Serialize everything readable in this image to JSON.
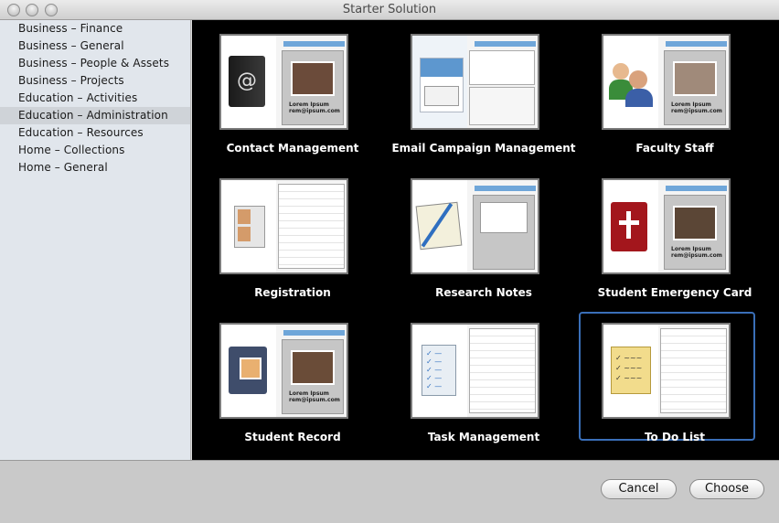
{
  "window": {
    "title": "Starter Solution"
  },
  "sidebar": {
    "items": [
      {
        "label": "Business – Finance",
        "selected": false
      },
      {
        "label": "Business – General",
        "selected": false
      },
      {
        "label": "Business – People & Assets",
        "selected": false
      },
      {
        "label": "Business – Projects",
        "selected": false
      },
      {
        "label": "Education – Activities",
        "selected": false
      },
      {
        "label": "Education – Administration",
        "selected": true
      },
      {
        "label": "Education – Resources",
        "selected": false
      },
      {
        "label": "Home – Collections",
        "selected": false
      },
      {
        "label": "Home – General",
        "selected": false
      }
    ]
  },
  "templates": [
    {
      "label": "Contact Management",
      "icon": "address-book-icon",
      "lorem": "Lorem Ipsum\nrem@ipsum.com"
    },
    {
      "label": "Email Campaign Management",
      "icon": "envelope-icon",
      "lorem": ""
    },
    {
      "label": "Faculty Staff",
      "icon": "people-icon",
      "lorem": "Lorem Ipsum\nrem@ipsum.com"
    },
    {
      "label": "Registration",
      "icon": "registration-cards-icon",
      "lorem": ""
    },
    {
      "label": "Research Notes",
      "icon": "notepad-pen-icon",
      "lorem": ""
    },
    {
      "label": "Student Emergency Card",
      "icon": "medical-book-icon",
      "lorem": "Lorem Ipsum\nrem@ipsum.com"
    },
    {
      "label": "Student Record",
      "icon": "photo-album-icon",
      "lorem": "Lorem Ipsum\nrem@ipsum.com"
    },
    {
      "label": "Task Management",
      "icon": "checklist-icon",
      "lorem": ""
    },
    {
      "label": "To Do List",
      "icon": "sticky-note-icon",
      "lorem": "",
      "selected": true
    }
  ],
  "footer": {
    "cancel_label": "Cancel",
    "choose_label": "Choose"
  },
  "colors": {
    "selection": "#3a6fb8",
    "gallery_bg": "#000000",
    "sidebar_bg": "#e1e6ec",
    "accent_tab": "#6fa6d9"
  }
}
